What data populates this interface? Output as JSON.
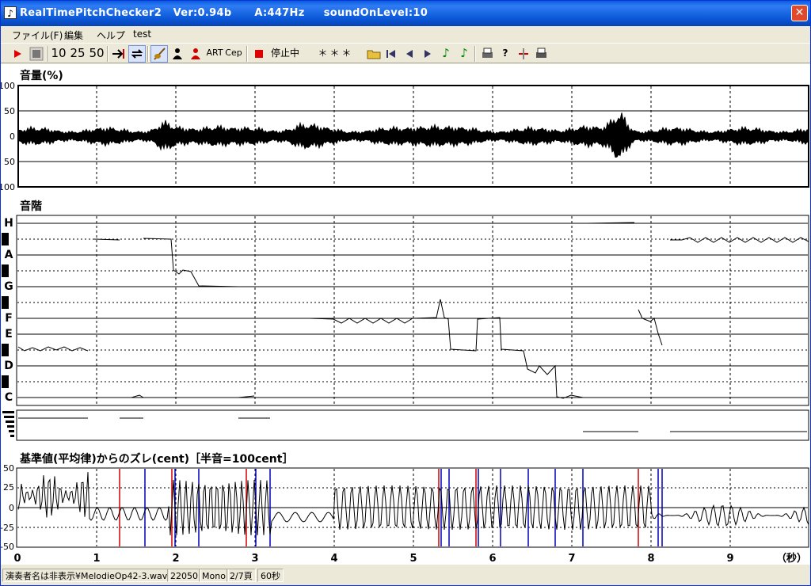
{
  "window": {
    "title": "RealTimePitchChecker2   Ver:0.94b      A:447Hz     soundOnLevel:10",
    "close_glyph": "✕",
    "app_icon_glyph": "♪"
  },
  "menu": [
    "ファイル(F)",
    "編集",
    "ヘルプ",
    "test"
  ],
  "toolbar": {
    "speed_10": "10",
    "speed_25": "25",
    "speed_50": "50",
    "art": "ART",
    "cep": "Cep",
    "status": "停止中",
    "note_display": "＊＊＊",
    "icons": [
      "play-icon",
      "stop-icon",
      "jump-end-icon",
      "loop-icon",
      "violin-icon",
      "person-icon",
      "singer-icon",
      "record-icon",
      "open-folder-icon",
      "first-icon",
      "prev-icon",
      "next-icon",
      "note-green-icon",
      "note-green2-icon",
      "print-icon",
      "help-icon",
      "marker-icon",
      "printer2-icon"
    ]
  },
  "panels": {
    "volume_title": "音量(%)",
    "volume_ticks": [
      "100",
      "50",
      "0",
      "50",
      "100"
    ],
    "scale_title": "音階",
    "scale_labels": [
      "H",
      "A",
      "G",
      "F",
      "E",
      "D",
      "C"
    ],
    "deviation_title": "基準値(平均律)からのズレ(cent)［半音=100cent］",
    "deviation_ticks": [
      "50",
      "25",
      "0",
      "-25",
      "-50"
    ],
    "time_ticks": [
      "0",
      "1",
      "2",
      "3",
      "4",
      "5",
      "6",
      "7",
      "8",
      "9"
    ],
    "time_unit": "（秒）"
  },
  "status_bar": [
    "演奏者名は非表示¥MelodieOp42-3.wav",
    "22050",
    "Mono",
    "2/7頁",
    "60秒"
  ],
  "colors": {
    "title_blue": "#0a5ce0",
    "red_marker": "#d00000",
    "blue_marker": "#0000c0",
    "play_red": "#e00000"
  }
}
